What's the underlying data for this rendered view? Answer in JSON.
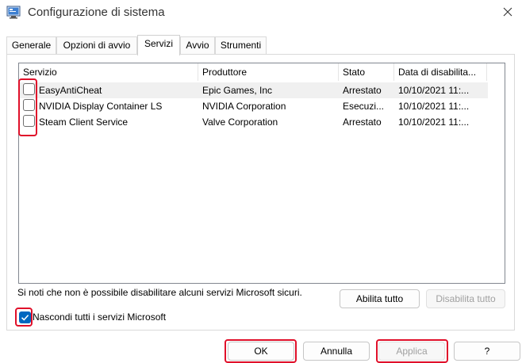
{
  "window": {
    "title": "Configurazione di sistema"
  },
  "tabs": [
    {
      "label": "Generale"
    },
    {
      "label": "Opzioni di avvio"
    },
    {
      "label": "Servizi"
    },
    {
      "label": "Avvio"
    },
    {
      "label": "Strumenti"
    }
  ],
  "active_tab": "Servizi",
  "services": {
    "columns": [
      "Servizio",
      "Produttore",
      "Stato",
      "Data di disabilita..."
    ],
    "rows": [
      {
        "name": "EasyAntiCheat",
        "manufacturer": "Epic Games, Inc",
        "status": "Arrestato",
        "date": "10/10/2021 11:...",
        "checked": false
      },
      {
        "name": "NVIDIA Display Container LS",
        "manufacturer": "NVIDIA Corporation",
        "status": "Esecuzi...",
        "date": "10/10/2021 11:...",
        "checked": false
      },
      {
        "name": "Steam Client Service",
        "manufacturer": "Valve Corporation",
        "status": "Arrestato",
        "date": "10/10/2021 11:...",
        "checked": false
      }
    ]
  },
  "note": "Si noti che non è possibile disabilitare alcuni servizi Microsoft sicuri.",
  "buttons": {
    "enable_all": "Abilita tutto",
    "disable_all": "Disabilita tutto",
    "ok": "OK",
    "cancel": "Annulla",
    "apply": "Applica",
    "help": "?"
  },
  "hide_microsoft": {
    "label": "Nascondi tutti i servizi Microsoft",
    "checked": true
  },
  "colors": {
    "accent": "#0067c0",
    "annotation": "#e0102a"
  },
  "icons": {
    "app": "system-config-icon",
    "close": "close-icon",
    "check": "checkmark-icon"
  }
}
